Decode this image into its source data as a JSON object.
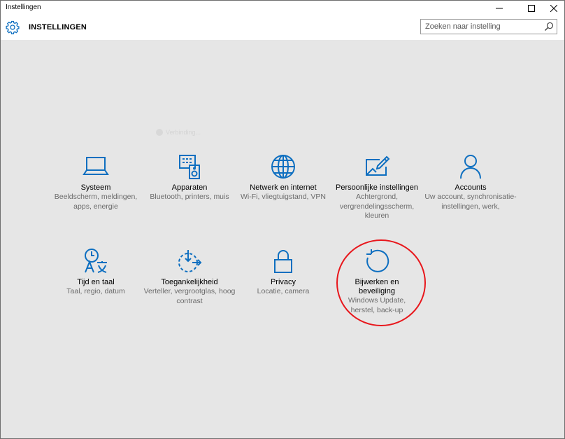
{
  "window": {
    "title": "Instellingen"
  },
  "header": {
    "title": "INSTELLINGEN"
  },
  "search": {
    "placeholder": "Zoeken naar instelling"
  },
  "faded_text": "Verbinding...",
  "tiles": [
    {
      "name": "Systeem",
      "desc": "Beeldscherm, meldingen, apps, energie",
      "icon": "laptop-icon"
    },
    {
      "name": "Apparaten",
      "desc": "Bluetooth, printers, muis",
      "icon": "devices-icon"
    },
    {
      "name": "Netwerk en internet",
      "desc": "Wi-Fi, vliegtuigstand, VPN",
      "icon": "globe-icon"
    },
    {
      "name": "Persoonlijke instellingen",
      "desc": "Achtergrond, vergrendelingsscherm, kleuren",
      "icon": "personalization-icon"
    },
    {
      "name": "Accounts",
      "desc": "Uw account, synchronisatie-instellingen, werk,",
      "icon": "person-icon"
    },
    {
      "name": "Tijd en taal",
      "desc": "Taal, regio, datum",
      "icon": "time-language-icon"
    },
    {
      "name": "Toegankelijkheid",
      "desc": "Verteller, vergrootglas, hoog contrast",
      "icon": "accessibility-icon"
    },
    {
      "name": "Privacy",
      "desc": "Locatie, camera",
      "icon": "lock-icon"
    },
    {
      "name": "Bijwerken en beveiliging",
      "desc": "Windows Update, herstel, back-up",
      "icon": "update-icon"
    }
  ],
  "colors": {
    "accent": "#0e6fc0",
    "background": "#e6e6e6",
    "highlight": "#e8161b"
  }
}
